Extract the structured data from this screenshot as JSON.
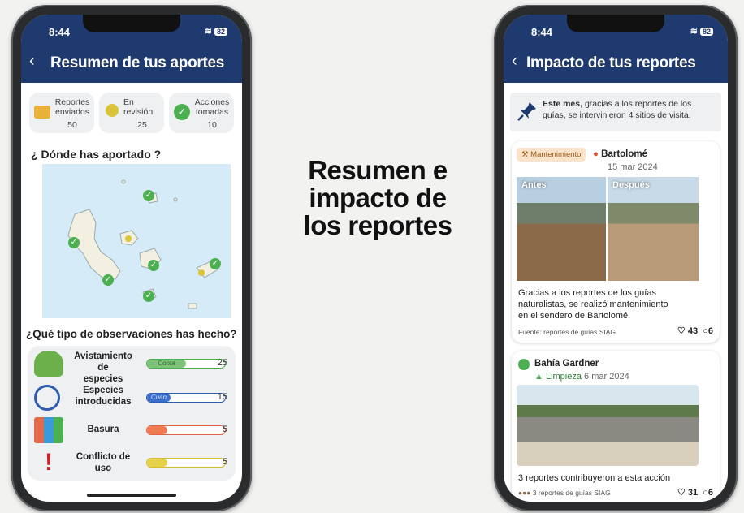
{
  "headline": {
    "line1": "Resumen e",
    "line2": "impacto de",
    "line3": "los reportes"
  },
  "left_phone": {
    "status_time": "8:44",
    "battery": "82",
    "title": "Resumen de tus aportes",
    "stats": [
      {
        "label_1": "Reportes",
        "label_2": "enviados",
        "value": "50",
        "icon": "briefcase-icon",
        "color": "#e8b23a"
      },
      {
        "label_1": "En",
        "label_2": "revisión",
        "value": "25",
        "icon": "pending-dot-icon",
        "color": "#d9c43a"
      },
      {
        "label_1": "Acciones",
        "label_2": "tomadas",
        "value": "10",
        "icon": "check-circle-icon",
        "color": "#4caf50"
      }
    ],
    "where_title": "¿ Dónde has aportado ?",
    "obs_title": "¿Qué tipo de observaciones has hecho?",
    "observations": [
      {
        "label_1": "Avistamiento de",
        "label_2": "especies",
        "bar_text": "Conta",
        "value": "25",
        "fraction": 0.5,
        "color": "#7cc47a",
        "border": "#4caf50",
        "icon": "turtle-icon"
      },
      {
        "label_1": "Especies",
        "label_2": "introducidas",
        "bar_text": "Cuan",
        "value": "15",
        "fraction": 0.3,
        "color": "#3a6fd0",
        "border": "#2f5bb0",
        "icon": "species-cycle-icon"
      },
      {
        "label_1": "Basura",
        "label_2": "",
        "bar_text": "",
        "value": "5",
        "fraction": 0.1,
        "color": "#f07b50",
        "border": "#e2634a",
        "icon": "trash-bins-icon"
      },
      {
        "label_1": "Conflicto de",
        "label_2": "uso",
        "bar_text": "",
        "value": "5",
        "fraction": 0.1,
        "color": "#e6d24a",
        "border": "#d6bc2a",
        "icon": "warning-icon"
      }
    ]
  },
  "right_phone": {
    "status_time": "8:44",
    "battery": "82",
    "title": "Impacto de tus reportes",
    "note_bold": "Este mes,",
    "note_rest_1": " gracias a los reportes de los",
    "note_rest_2": "guías, se intervinieron 4 sitios de visita.",
    "card1": {
      "chip": "Mantenimiento",
      "location": "Bartolomé",
      "date": "15 mar 2024",
      "before": "Antes",
      "after": "Después",
      "text_1": "Gracias a los reportes de los guías",
      "text_2": "naturalistas, se realizó mantenimiento",
      "text_3": "en el sendero de Bartolomé.",
      "source": "Fuente: reportes de guías SIAG",
      "likes": "43",
      "comments": "6"
    },
    "card2": {
      "location": "Bahía Gardner",
      "category": "Limpieza",
      "date": "6 mar 2024",
      "text": "3 reportes contribuyeron a esta acción",
      "source": "3 reportes de guías SIAG",
      "likes": "31",
      "comments": "6"
    }
  }
}
